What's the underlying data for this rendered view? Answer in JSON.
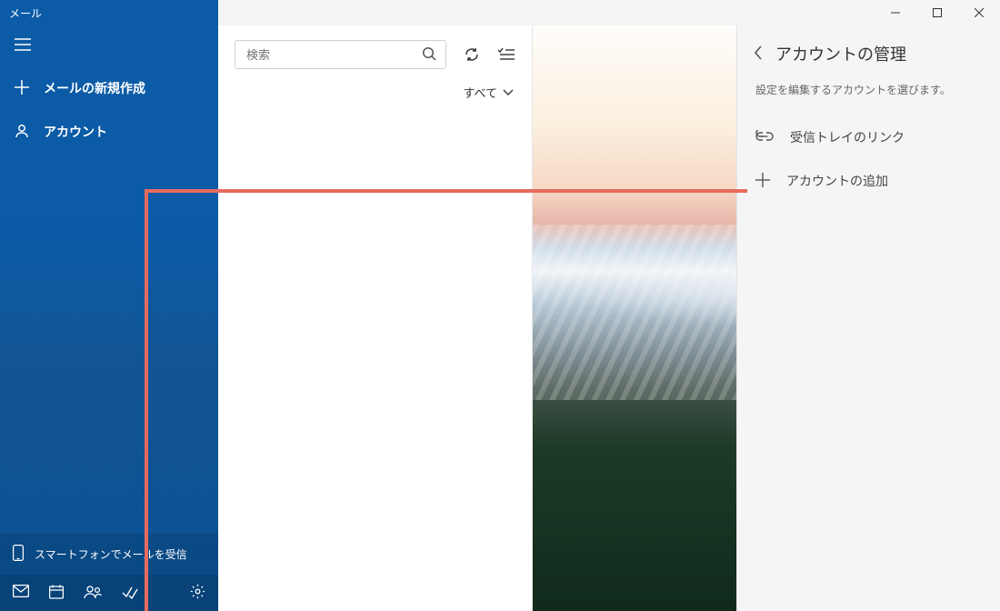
{
  "app_title": "メール",
  "window_controls": {
    "min": "–",
    "max": "▢",
    "close": "✕"
  },
  "sidebar": {
    "compose_label": "メールの新規作成",
    "accounts_label": "アカウント",
    "promo_label": "スマートフォンでメールを受信"
  },
  "list": {
    "search_placeholder": "検索",
    "filter_label": "すべて"
  },
  "settings": {
    "title": "アカウントの管理",
    "description": "設定を編集するアカウントを選びます。",
    "link_inboxes_label": "受信トレイのリンク",
    "add_account_label": "アカウントの追加"
  }
}
